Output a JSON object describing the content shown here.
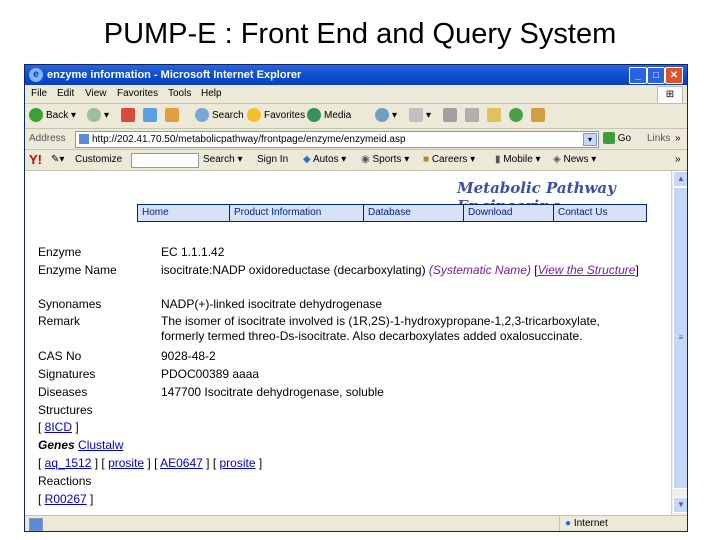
{
  "slide": {
    "title": "PUMP-E : Front End and Query System"
  },
  "window": {
    "title": "enzyme information - Microsoft Internet Explorer",
    "controls": [
      "_",
      "□",
      "✕"
    ]
  },
  "menu": [
    "File",
    "Edit",
    "View",
    "Favorites",
    "Tools",
    "Help"
  ],
  "toolbar": {
    "back": "Back",
    "search": "Search",
    "favorites": "Favorites",
    "media": "Media"
  },
  "address": {
    "label": "Address",
    "url": "http://202.41.70.50/metabolicpathway/frontpage/enzyme/enzymeid.asp",
    "go": "Go",
    "links": "Links"
  },
  "links_bar": {
    "customize": "Customize",
    "search": "Search",
    "signin": "Sign In",
    "autos": "Autos",
    "sports": "Sports",
    "careers": "Careers",
    "mobile": "Mobile",
    "news": "News"
  },
  "page": {
    "brand": "Metabolic Pathway Engineering",
    "nav": [
      "Home",
      "Product Information",
      "Database",
      "Download",
      "Contact Us"
    ],
    "fields": {
      "enzyme_label": "Enzyme",
      "enzyme_value": "EC 1.1.1.42",
      "name_label": "Enzyme Name",
      "name_value": "isocitrate:NADP oxidoreductase (decarboxylating)",
      "name_note": "(Systematic Name)",
      "name_link": "View the Structure",
      "synonyms_label": "Synonames",
      "synonyms_value": "NADP(+)-linked isocitrate dehydrogenase",
      "remark_label": "Remark",
      "remark_value": "The isomer of isocitrate involved is (1R,2S)-1-hydroxypropane-1,2,3-tricarboxylate, formerly termed threo-Ds-isocitrate. Also decarboxylates added oxalosuccinate.",
      "cas_label": "CAS No",
      "cas_value": "9028-48-2",
      "signatures_label": "Signatures",
      "signatures_value": "PDOC00389 aaaa",
      "diseases_label": "Diseases",
      "diseases_value": "147700 Isocitrate dehydrogenase, soluble",
      "structures_label": "Structures",
      "structures_link": "8ICD",
      "genes_label": "Genes",
      "genes_link": "Clustalw",
      "gene_links": [
        "aq_1512",
        "prosite",
        "AE0647",
        "prosite"
      ],
      "reactions_label": "Reactions",
      "reactions_link": "R00267"
    }
  },
  "status": {
    "zone": "Internet"
  }
}
